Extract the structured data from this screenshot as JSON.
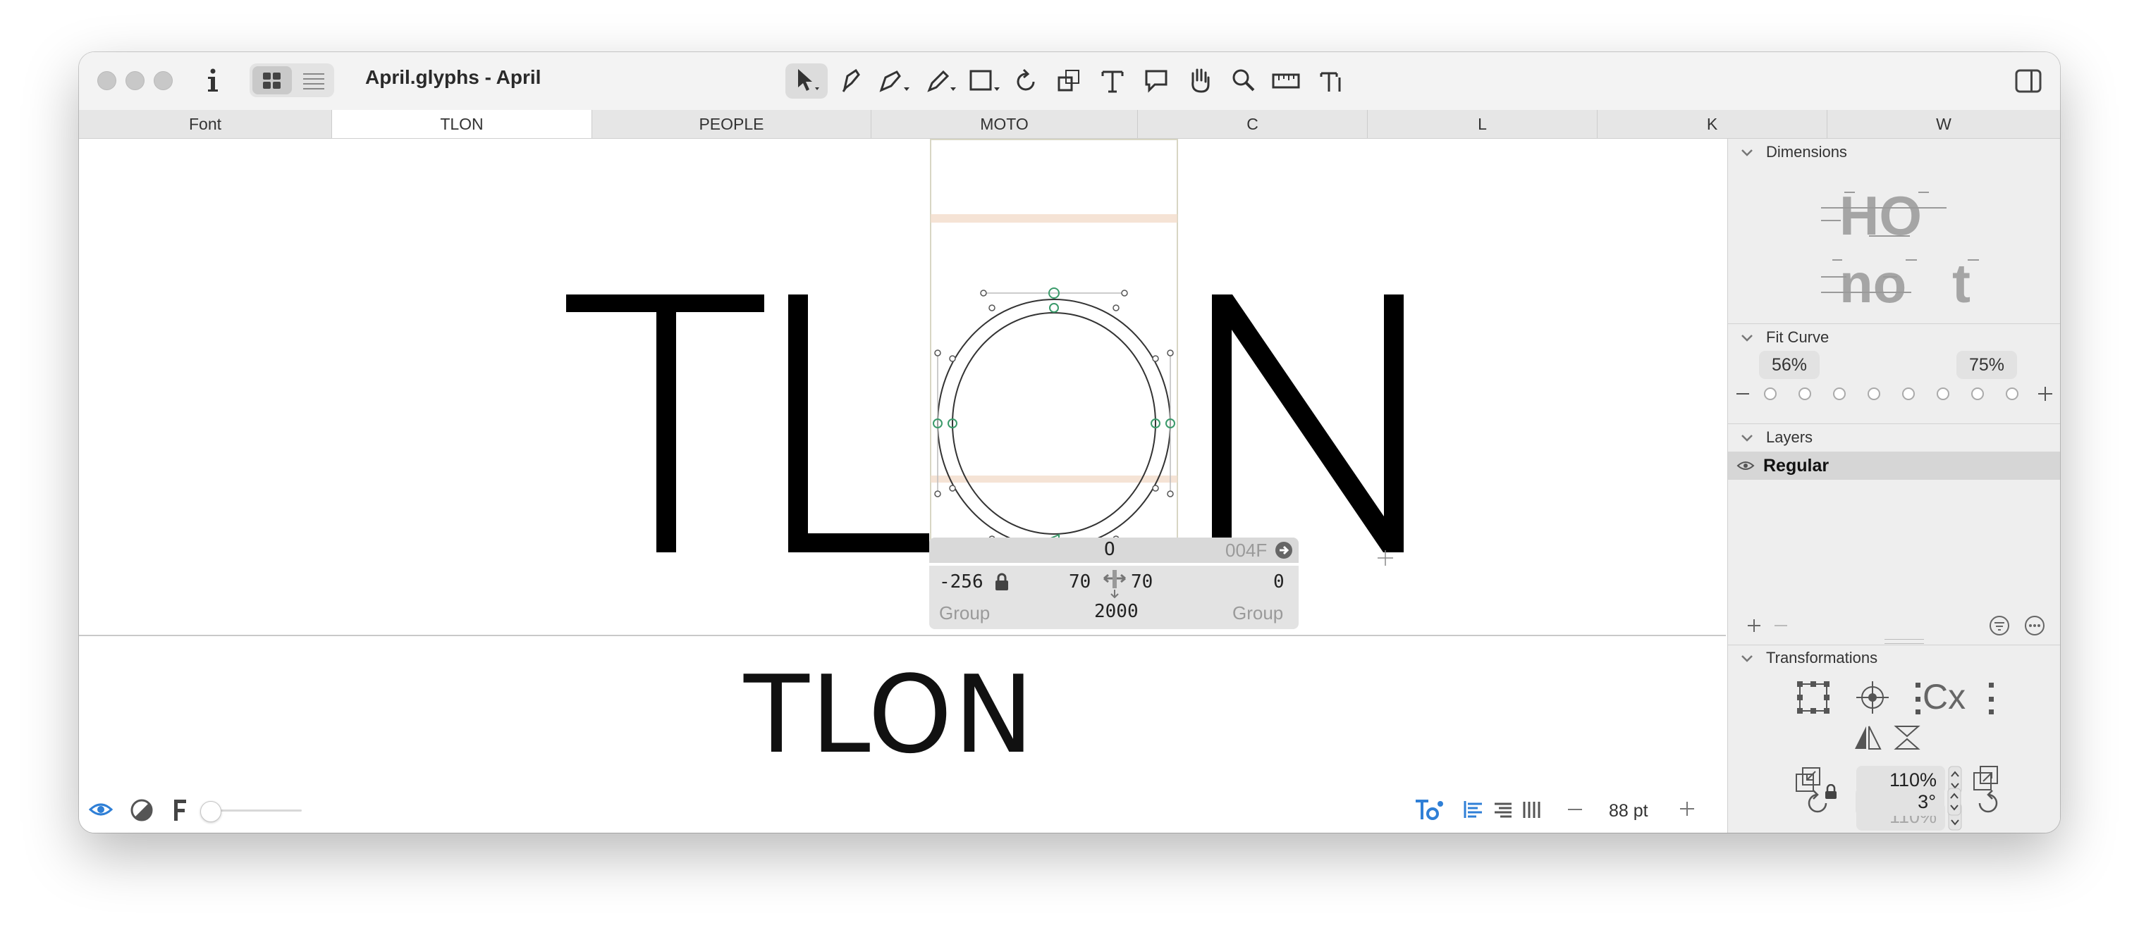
{
  "window": {
    "title": "April.glyphs - April"
  },
  "tabs": [
    {
      "label": "Font"
    },
    {
      "label": "TLON"
    },
    {
      "label": "PEOPLE"
    },
    {
      "label": "MOTO"
    },
    {
      "label": "C"
    },
    {
      "label": "L"
    },
    {
      "label": "K"
    },
    {
      "label": "W"
    }
  ],
  "edit": {
    "glyphs": {
      "t": "T",
      "l": "L",
      "n": "N"
    }
  },
  "info_box": {
    "glyph_name": "O",
    "unicode": "004F",
    "x_offset": "-256",
    "lsb": "70",
    "rsb": "70",
    "y_value": "0",
    "left_group": "Group",
    "width": "2000",
    "right_group": "Group"
  },
  "preview": {
    "text": "TLON"
  },
  "bottom_bar": {
    "font_size": "88 pt"
  },
  "sidebar": {
    "dimensions": {
      "title": "Dimensions",
      "sample1": "HO",
      "sample2": "no",
      "sample3": "t"
    },
    "fit_curve": {
      "title": "Fit Curve",
      "left_value": "56%",
      "right_value": "75%"
    },
    "layers": {
      "title": "Layers",
      "items": [
        {
          "label": "Regular"
        }
      ]
    },
    "transformations": {
      "title": "Transformations",
      "cx_label": "Cx",
      "scale_x": "110%",
      "scale_y": "110%",
      "rotate": "3°"
    }
  },
  "colors": {
    "accent_blue": "#2f7fd6",
    "node_green": "#3a9a6a",
    "metric_band": "#f3dccb"
  }
}
